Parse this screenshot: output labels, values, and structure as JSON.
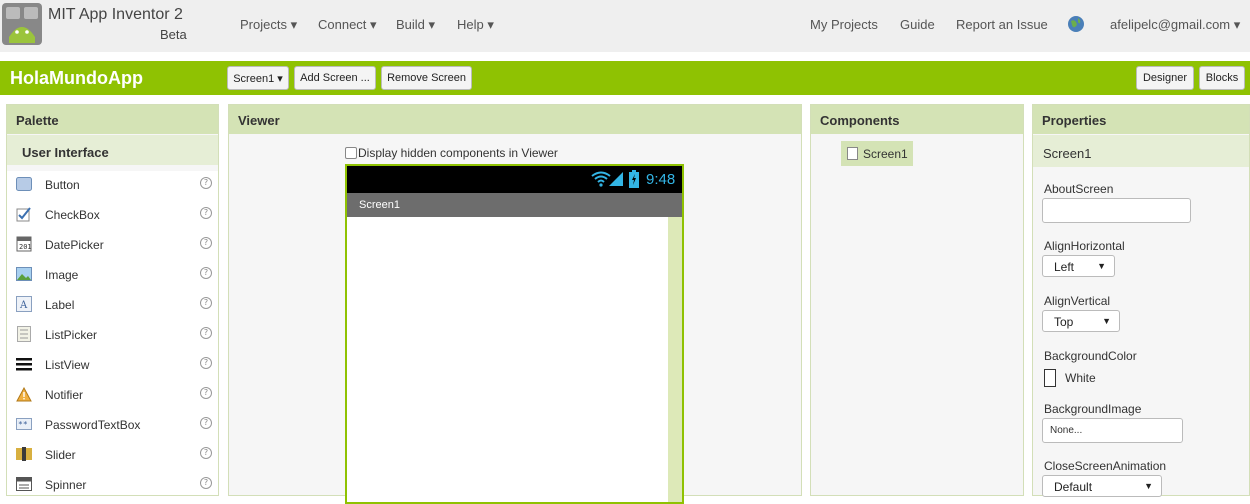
{
  "topbar": {
    "title": "MIT App Inventor 2",
    "subtitle": "Beta",
    "menus": [
      "Projects ▾",
      "Connect ▾",
      "Build ▾",
      "Help ▾"
    ],
    "links": [
      "My Projects",
      "Guide",
      "Report an Issue"
    ],
    "user": "afelipelc@gmail.com ▾"
  },
  "project": {
    "name": "HolaMundoApp",
    "screen_select": "Screen1 ▾",
    "add_screen": "Add Screen ...",
    "remove_screen": "Remove Screen",
    "designer": "Designer",
    "blocks": "Blocks"
  },
  "palette": {
    "title": "Palette",
    "category": "User Interface",
    "items": [
      {
        "label": "Button",
        "icon": "button-icon"
      },
      {
        "label": "CheckBox",
        "icon": "checkbox-icon"
      },
      {
        "label": "DatePicker",
        "icon": "datepicker-icon"
      },
      {
        "label": "Image",
        "icon": "image-icon"
      },
      {
        "label": "Label",
        "icon": "label-icon"
      },
      {
        "label": "ListPicker",
        "icon": "listpicker-icon"
      },
      {
        "label": "ListView",
        "icon": "listview-icon"
      },
      {
        "label": "Notifier",
        "icon": "notifier-icon"
      },
      {
        "label": "PasswordTextBox",
        "icon": "passwordtextbox-icon"
      },
      {
        "label": "Slider",
        "icon": "slider-icon"
      },
      {
        "label": "Spinner",
        "icon": "spinner-icon"
      }
    ],
    "help": "?"
  },
  "viewer": {
    "title": "Viewer",
    "checkbox_label": "Display hidden components in Viewer",
    "time": "9:48",
    "screen_title": "Screen1"
  },
  "components": {
    "title": "Components",
    "items": [
      "Screen1"
    ]
  },
  "properties": {
    "title": "Properties",
    "component": "Screen1",
    "about_label": "AboutScreen",
    "align_h_label": "AlignHorizontal",
    "align_h_value": "Left",
    "align_v_label": "AlignVertical",
    "align_v_value": "Top",
    "bg_color_label": "BackgroundColor",
    "bg_color_value": "White",
    "bg_image_label": "BackgroundImage",
    "bg_image_value": "None...",
    "close_anim_label": "CloseScreenAnimation",
    "close_anim_value": "Default",
    "arrow": "▼"
  },
  "colors": {
    "accent_green": "#8fc202",
    "panel_head": "#d4e3b5"
  }
}
